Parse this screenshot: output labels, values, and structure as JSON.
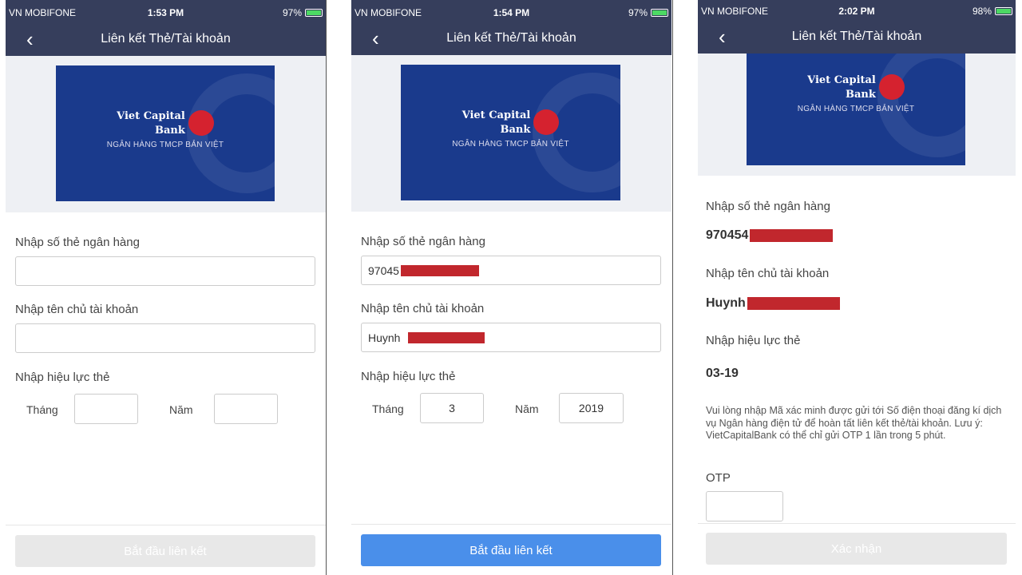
{
  "status_bars": [
    {
      "carrier": "VN MOBIFONE",
      "time": "1:53 PM",
      "battery": "97%"
    },
    {
      "carrier": "VN MOBIFONE",
      "time": "1:54 PM",
      "battery": "97%"
    },
    {
      "carrier": "VN MOBIFONE",
      "time": "2:02 PM",
      "battery": "98%"
    }
  ],
  "nav_title": "Liên kết Thẻ/Tài khoản",
  "bank": {
    "name_line1": "Viet Capital",
    "name_line2": "Bank",
    "subtitle": "NGÂN HÀNG TMCP BẢN VIỆT"
  },
  "form": {
    "card_number_label": "Nhập số thẻ ngân hàng",
    "holder_label": "Nhập tên chủ tài khoản",
    "validity_label": "Nhập hiệu lực thẻ",
    "month_label": "Tháng",
    "year_label": "Năm"
  },
  "screen2": {
    "card_number": "97045",
    "holder": "Huynh",
    "month": "3",
    "year": "2019"
  },
  "screen3": {
    "card_number": "970454",
    "holder": "Huynh",
    "validity": "03-19",
    "instructions": "Vui lòng nhập Mã xác minh được gửi tới Số điện thoại đăng kí dịch vụ Ngân hàng điện tử để hoàn tất liên kết thẻ/tài khoản. Lưu ý: VietCapitalBank có thể chỉ gửi OTP 1 lần trong 5 phút.",
    "otp_label": "OTP"
  },
  "buttons": {
    "start_link": "Bắt đầu liên kết",
    "confirm": "Xác nhận"
  },
  "colors": {
    "nav": "#363e5c",
    "primary": "#4a8fea",
    "redaction": "#c1272d",
    "card": "#1a3a8c"
  }
}
